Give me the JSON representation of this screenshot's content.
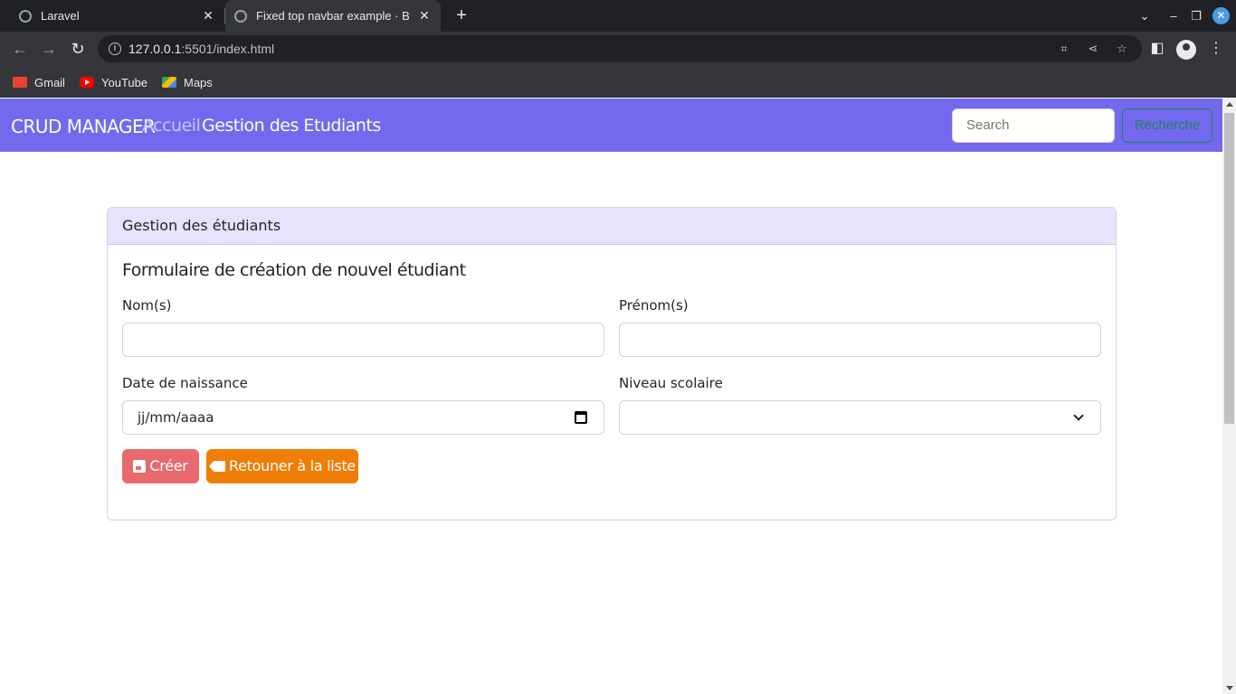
{
  "browser": {
    "tabs": [
      {
        "title": "Laravel"
      },
      {
        "title": "Fixed top navbar example · B"
      }
    ],
    "url_host": "127.0.0.1",
    "url_rest": ":5501/index.html",
    "bookmarks": [
      {
        "label": "Gmail"
      },
      {
        "label": "YouTube"
      },
      {
        "label": "Maps"
      }
    ]
  },
  "navbar": {
    "brand": "CRUD MANAGER",
    "links": [
      {
        "label": "Accueil"
      },
      {
        "label": "Gestion des Etudiants"
      }
    ],
    "search_placeholder": "Search",
    "search_button": "Recherche"
  },
  "card": {
    "header": "Gestion des étudiants",
    "title": "Formulaire de création de nouvel étudiant",
    "fields": {
      "nom_label": "Nom(s)",
      "nom_value": "",
      "prenom_label": "Prénom(s)",
      "prenom_value": "",
      "date_label": "Date de naissance",
      "date_placeholder": "jj/mm/aaaa",
      "niveau_label": "Niveau scolaire",
      "niveau_value": ""
    },
    "buttons": {
      "create": "Créer",
      "back": "Retouner à la liste"
    }
  },
  "colors": {
    "navbar": "#7468ee",
    "card_header": "#e6e3fd",
    "create_button": "#e8696e",
    "back_button": "#f07d05",
    "search_button": "#198754"
  }
}
